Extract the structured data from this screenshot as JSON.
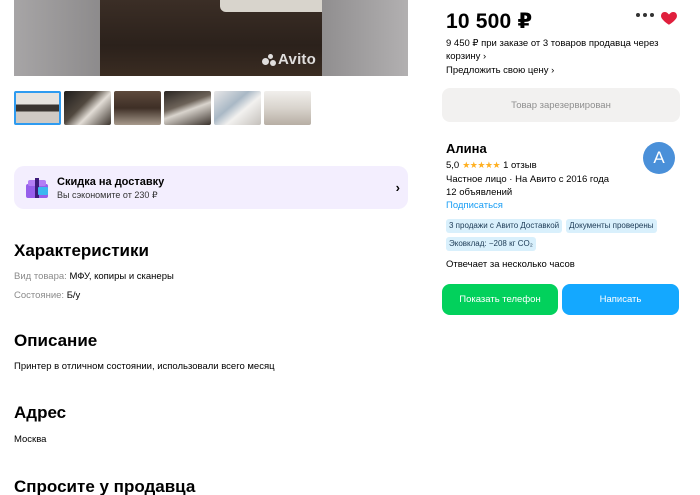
{
  "gallery": {
    "watermark": "Avito",
    "thumbnail_count": 6
  },
  "delivery_banner": {
    "title": "Скидка на доставку",
    "subtitle": "Вы сэкономите от 230 ₽"
  },
  "characteristics": {
    "heading": "Характеристики",
    "rows": [
      {
        "label": "Вид товара:",
        "value": "МФУ, копиры и сканеры"
      },
      {
        "label": "Состояние:",
        "value": "Б/у"
      }
    ]
  },
  "description": {
    "heading": "Описание",
    "text": "Принтер в отличном состоянии, использовали всего месяц"
  },
  "address": {
    "heading": "Адрес",
    "text": "Москва"
  },
  "ask_seller": {
    "heading": "Спросите у продавца"
  },
  "listing": {
    "price": "10 500 ₽",
    "promo": "9 450 ₽ при заказе от 3 товаров продавца через корзину ›",
    "offer_link": "Предложить свою цену ›",
    "reserved_label": "Товар зарезервирован"
  },
  "seller": {
    "name": "Алина",
    "avatar_letter": "A",
    "rating": "5,0",
    "stars": "★★★★★",
    "reviews": "1 отзыв",
    "type_since": "Частное лицо · На Авито с 2016 года",
    "listings_count": "12 объявлений",
    "subscribe_label": "Подписаться",
    "badges": [
      "3 продажи с Авито Доставкой",
      "Документы проверены",
      "Эковклад: −208 кг CO₂"
    ],
    "response_time": "Отвечает за несколько часов"
  },
  "actions": {
    "show_phone": "Показать телефон",
    "write": "Написать"
  },
  "colors": {
    "accent_blue": "#14a8ff",
    "phone_green": "#02d15c",
    "favorite_red": "#e01f3d",
    "delivery_bg": "#f3eefe"
  }
}
